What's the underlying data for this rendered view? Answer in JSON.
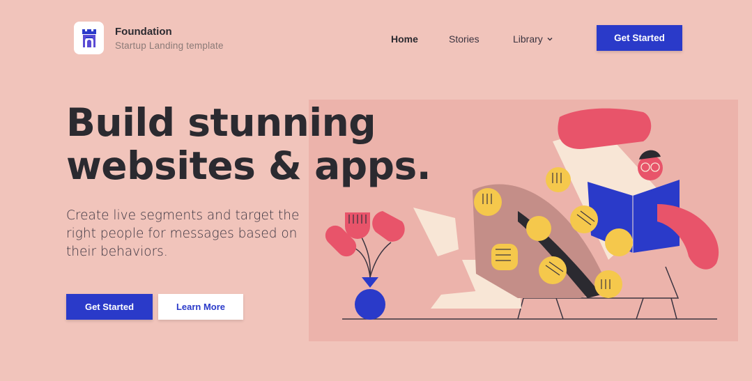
{
  "header": {
    "brand_title": "Foundation",
    "brand_subtitle": "Startup Landing template",
    "logo_icon": "castle-tower-icon",
    "nav": [
      {
        "label": "Home",
        "active": true
      },
      {
        "label": "Stories",
        "active": false
      },
      {
        "label": "Library",
        "active": false,
        "has_dropdown": true
      }
    ],
    "cta_label": "Get Started"
  },
  "hero": {
    "title_line1": "Build stunning",
    "title_line2": "websites & apps.",
    "description": "Create live segments and target the right people for messages based on their behaviors.",
    "primary_label": "Get Started",
    "secondary_label": "Learn More",
    "illustration": "person-reading-book-illustration"
  },
  "colors": {
    "background": "#f1c4bb",
    "illustration_bg": "#ecb3ab",
    "accent": "#2a3ac9",
    "text": "#2b2a30",
    "red": "#e8546a",
    "yellow": "#f5c84c",
    "cream": "#f8e6d6"
  }
}
